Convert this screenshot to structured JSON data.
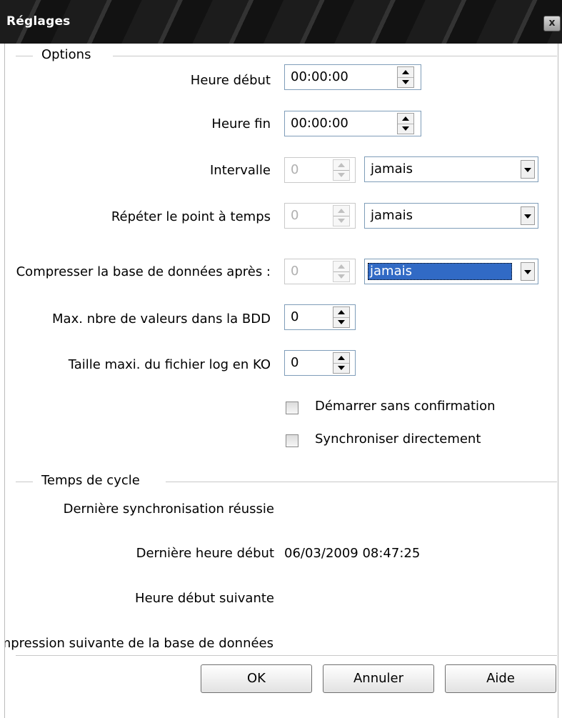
{
  "window": {
    "title": "Réglages",
    "close_glyph": "x"
  },
  "options": {
    "group_label": "Options",
    "heure_debut": {
      "label": "Heure début",
      "value": "00:00:00"
    },
    "heure_fin": {
      "label": "Heure fin",
      "value": "00:00:00"
    },
    "intervalle": {
      "label": "Intervalle",
      "value": "0",
      "unit": "jamais"
    },
    "repeter": {
      "label": "Répéter le point à temps",
      "value": "0",
      "unit": "jamais"
    },
    "compresser": {
      "label": "Compresser la base de données après :",
      "value": "0",
      "unit": "jamais"
    },
    "max_valeurs": {
      "label": "Max. nbre de valeurs dans la BDD",
      "value": "0"
    },
    "taille_log": {
      "label": "Taille maxi. du fichier log en KO",
      "value": "0"
    },
    "demarrer": {
      "label": "Démarrer sans confirmation",
      "checked": false
    },
    "synchroniser": {
      "label": "Synchroniser directement",
      "checked": false
    }
  },
  "cycle": {
    "group_label": "Temps de cycle",
    "derniere_sync": {
      "label": "Dernière synchronisation réussie",
      "value": ""
    },
    "derniere_heure": {
      "label": "Dernière heure début",
      "value": "06/03/2009 08:47:25"
    },
    "heure_suivante": {
      "label": "Heure début suivante",
      "value": ""
    },
    "compression_suivante": {
      "label": "Compression suivante de la base de données",
      "value": ""
    }
  },
  "buttons": {
    "ok": "OK",
    "cancel": "Annuler",
    "help": "Aide"
  },
  "colors": {
    "titlebar": "#1c1c1c",
    "selection": "#316ac5",
    "field_border": "#7f9db9"
  }
}
